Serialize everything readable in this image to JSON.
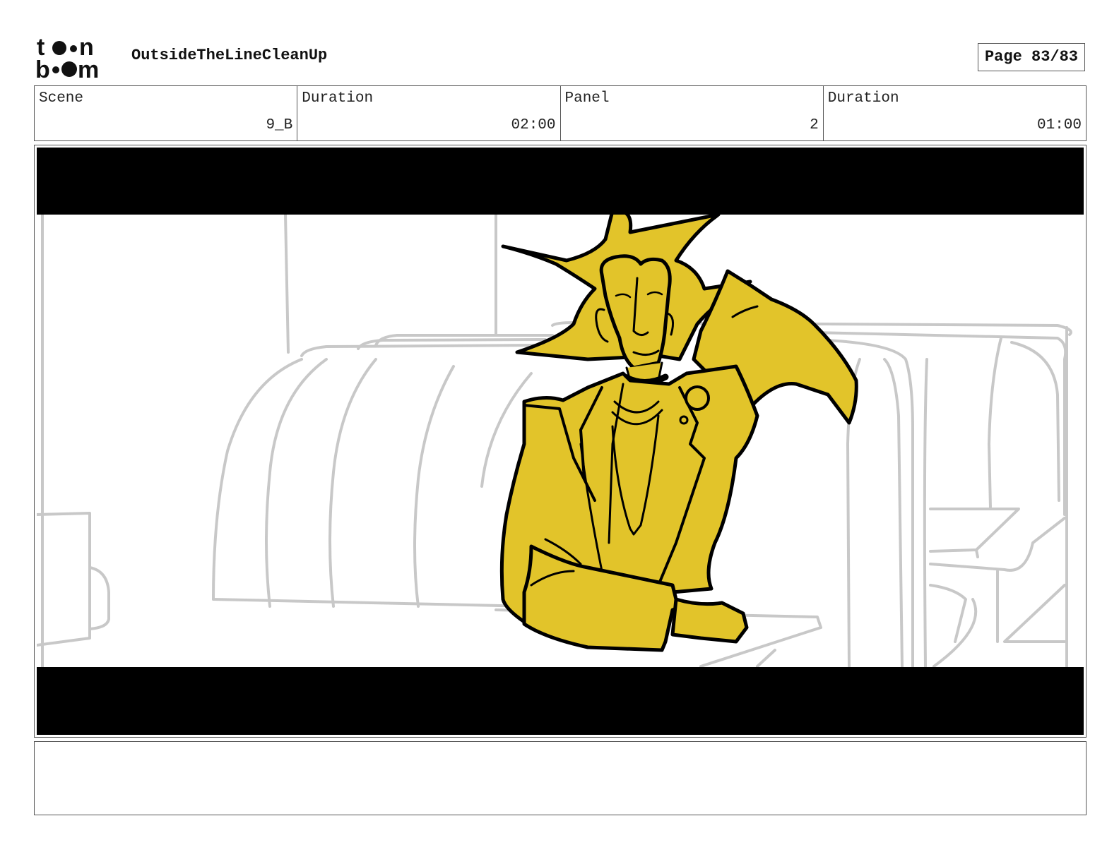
{
  "header": {
    "logo_text": "toon boom",
    "project_title": "OutsideTheLineCleanUp",
    "page_label": "Page 83/83"
  },
  "info": {
    "scene_label": "Scene",
    "scene_value": "9_B",
    "scene_duration_label": "Duration",
    "scene_duration_value": "02:00",
    "panel_label": "Panel",
    "panel_value": "2",
    "panel_duration_label": "Duration",
    "panel_duration_value": "01:00"
  },
  "panel": {
    "character_color": "#e2c42a",
    "background_line_color": "#c8c8c8",
    "letterbox_color": "#000000"
  },
  "caption": {
    "text": ""
  }
}
